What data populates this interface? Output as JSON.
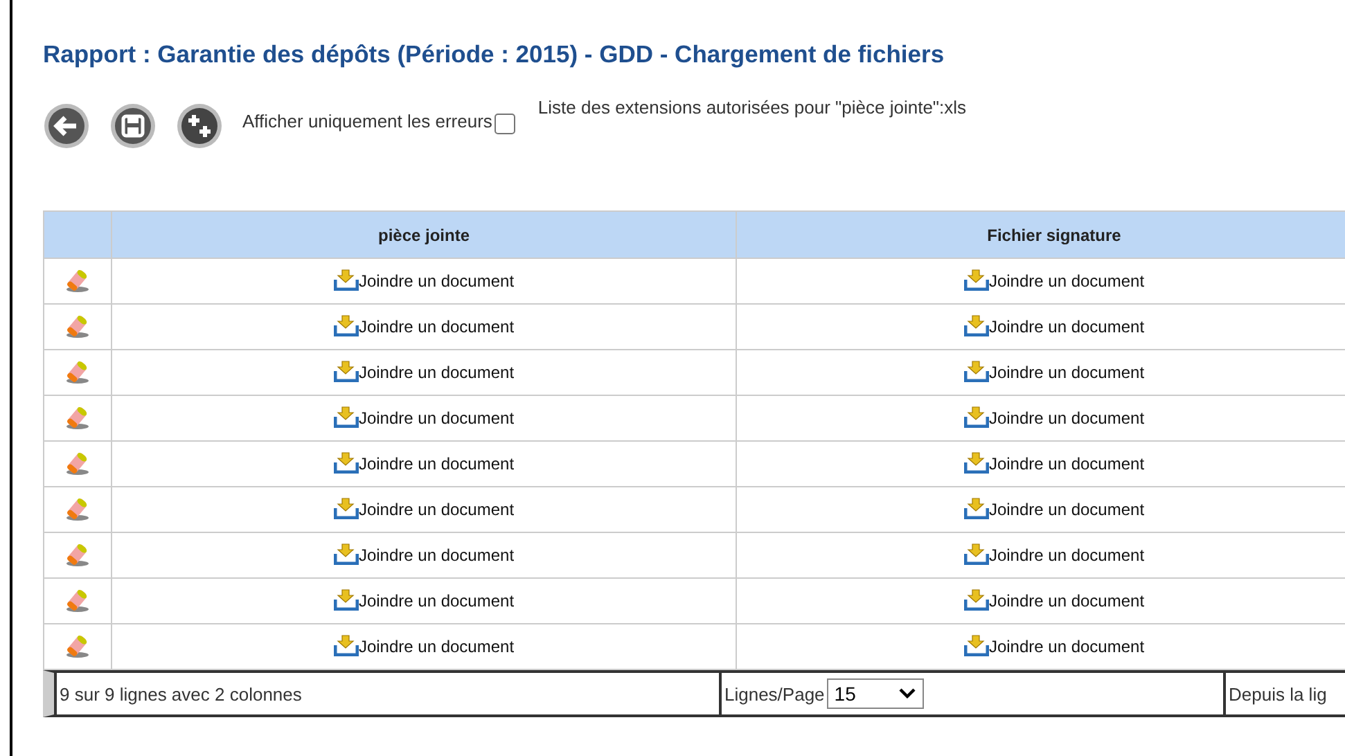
{
  "title": "Rapport : Garantie des dépôts (Période : 2015) - GDD - Chargement de fichiers",
  "toolbar": {
    "filter_label": "Afficher uniquement les erreurs",
    "filter_checked": false,
    "extensions_note": "Liste des extensions autorisées pour \"pièce jointe\":xls"
  },
  "table": {
    "columns": [
      "pièce jointe",
      "Fichier signature"
    ],
    "rows": [
      {
        "cells": [
          "Joindre un document",
          "Joindre un document"
        ]
      },
      {
        "cells": [
          "Joindre un document",
          "Joindre un document"
        ]
      },
      {
        "cells": [
          "Joindre un document",
          "Joindre un document"
        ]
      },
      {
        "cells": [
          "Joindre un document",
          "Joindre un document"
        ]
      },
      {
        "cells": [
          "Joindre un document",
          "Joindre un document"
        ]
      },
      {
        "cells": [
          "Joindre un document",
          "Joindre un document"
        ]
      },
      {
        "cells": [
          "Joindre un document",
          "Joindre un document"
        ]
      },
      {
        "cells": [
          "Joindre un document",
          "Joindre un document"
        ]
      },
      {
        "cells": [
          "Joindre un document",
          "Joindre un document"
        ]
      }
    ]
  },
  "footer": {
    "summary": "9 sur 9 lignes avec 2 colonnes",
    "page_size_label": "Lignes/Page",
    "page_size_value": "15",
    "from_label": "Depuis la lig"
  }
}
